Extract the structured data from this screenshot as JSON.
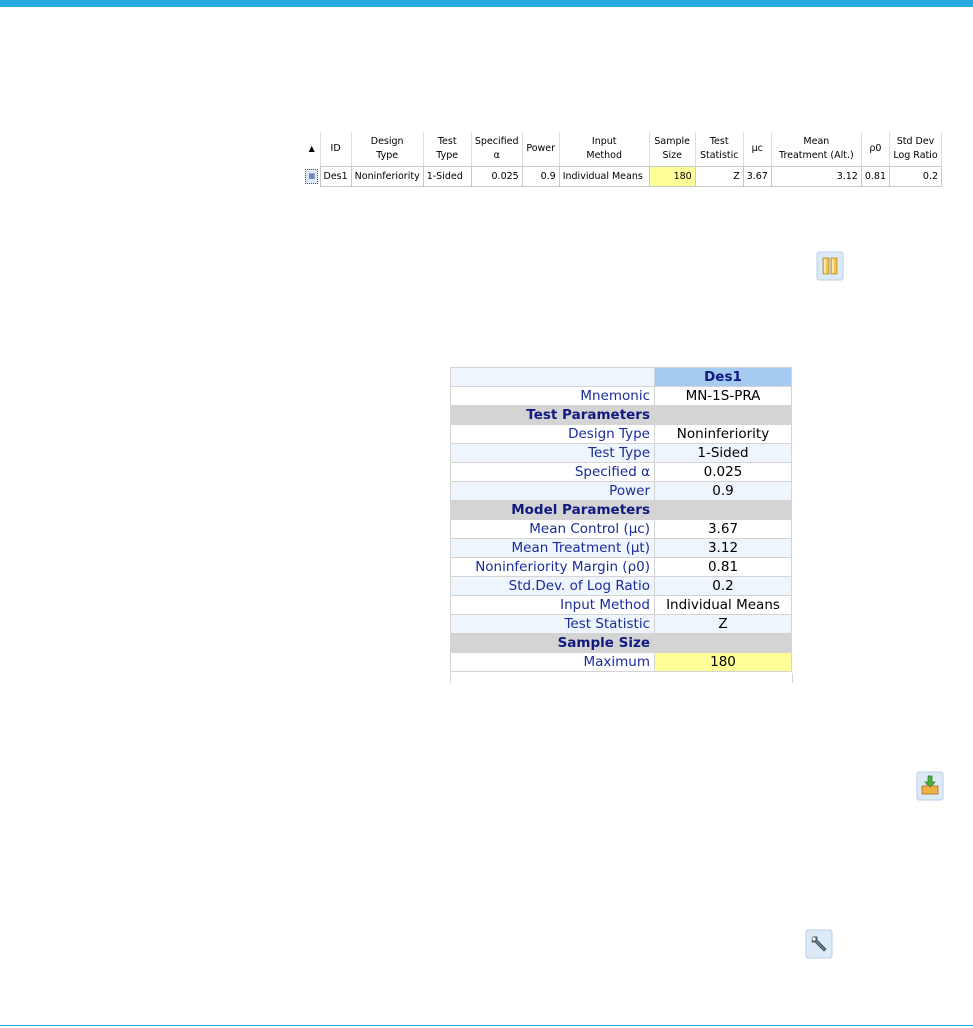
{
  "grid": {
    "sort_indicator": "▲",
    "headers": [
      [
        "ID"
      ],
      [
        "Design",
        "Type"
      ],
      [
        "Test",
        "Type"
      ],
      [
        "Specified",
        "α"
      ],
      [
        "Power"
      ],
      [
        "Input",
        "Method"
      ],
      [
        "Sample",
        "Size"
      ],
      [
        "Test",
        "Statistic"
      ],
      [
        "μc"
      ],
      [
        "Mean",
        "Treatment (Alt.)"
      ],
      [
        "ρ0"
      ],
      [
        "Std Dev",
        "Log Ratio"
      ]
    ],
    "row": {
      "id": "Des1",
      "design_type": "Noninferiority",
      "test_type": "1-Sided",
      "specified_alpha": "0.025",
      "power": "0.9",
      "input_method": "Individual Means",
      "sample_size": "180",
      "test_statistic": "Z",
      "mu_c": "3.67",
      "mean_treatment": "3.12",
      "rho0": "0.81",
      "std_dev": "0.2"
    }
  },
  "toolbar_icons": {
    "compare": "compare-plots-icon",
    "save": "save-to-workbook-icon",
    "edit": "edit-design-icon"
  },
  "details": {
    "column_header": "Des1",
    "mnemonic_label": "Mnemonic",
    "mnemonic_value": "MN-1S-PRA",
    "section_test": "Test Parameters",
    "design_type_label": "Design Type",
    "design_type_value": "Noninferiority",
    "test_type_label": "Test Type",
    "test_type_value": "1-Sided",
    "alpha_label": "Specified α",
    "alpha_value": "0.025",
    "power_label": "Power",
    "power_value": "0.9",
    "section_model": "Model Parameters",
    "mean_control_label": "Mean Control (μc)",
    "mean_control_value": "3.67",
    "mean_treatment_label": "Mean Treatment (μt)",
    "mean_treatment_value": "3.12",
    "margin_label": "Noninferiority Margin (ρ0)",
    "margin_value": "0.81",
    "stddev_label": "Std.Dev. of Log Ratio",
    "stddev_value": "0.2",
    "input_method_label": "Input Method",
    "input_method_value": "Individual Means",
    "test_stat_label": "Test Statistic",
    "test_stat_value": "Z",
    "section_sample": "Sample Size",
    "maximum_label": "Maximum",
    "maximum_value": "180"
  },
  "colors": {
    "accent": "#29a9e1",
    "highlight": "#ffff99",
    "label_blue": "#1a2c9a",
    "header_blue": "#a6cbf0"
  }
}
